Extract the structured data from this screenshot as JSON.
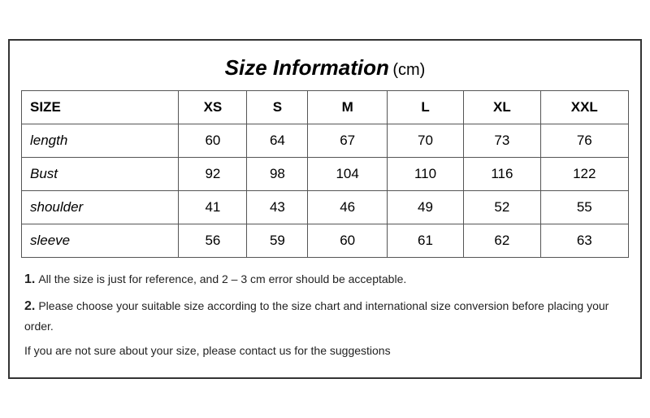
{
  "title": {
    "main": "Size Information",
    "unit": "(cm)"
  },
  "table": {
    "headers": [
      "SIZE",
      "XS",
      "S",
      "M",
      "L",
      "XL",
      "XXL"
    ],
    "rows": [
      {
        "label": "length",
        "values": [
          "60",
          "64",
          "67",
          "70",
          "73",
          "76"
        ]
      },
      {
        "label": "Bust",
        "values": [
          "92",
          "98",
          "104",
          "110",
          "116",
          "122"
        ]
      },
      {
        "label": "shoulder",
        "values": [
          "41",
          "43",
          "46",
          "49",
          "52",
          "55"
        ]
      },
      {
        "label": "sleeve",
        "values": [
          "56",
          "59",
          "60",
          "61",
          "62",
          "63"
        ]
      }
    ]
  },
  "notes": [
    {
      "number": "1.",
      "text": "All the size is just for reference, and 2 – 3 cm error should be acceptable."
    },
    {
      "number": "2.",
      "text": "Please choose your suitable size according to the size chart and international size conversion before placing your order."
    },
    {
      "number": "",
      "text": "If you are not sure about your size, please contact us for the suggestions"
    }
  ]
}
